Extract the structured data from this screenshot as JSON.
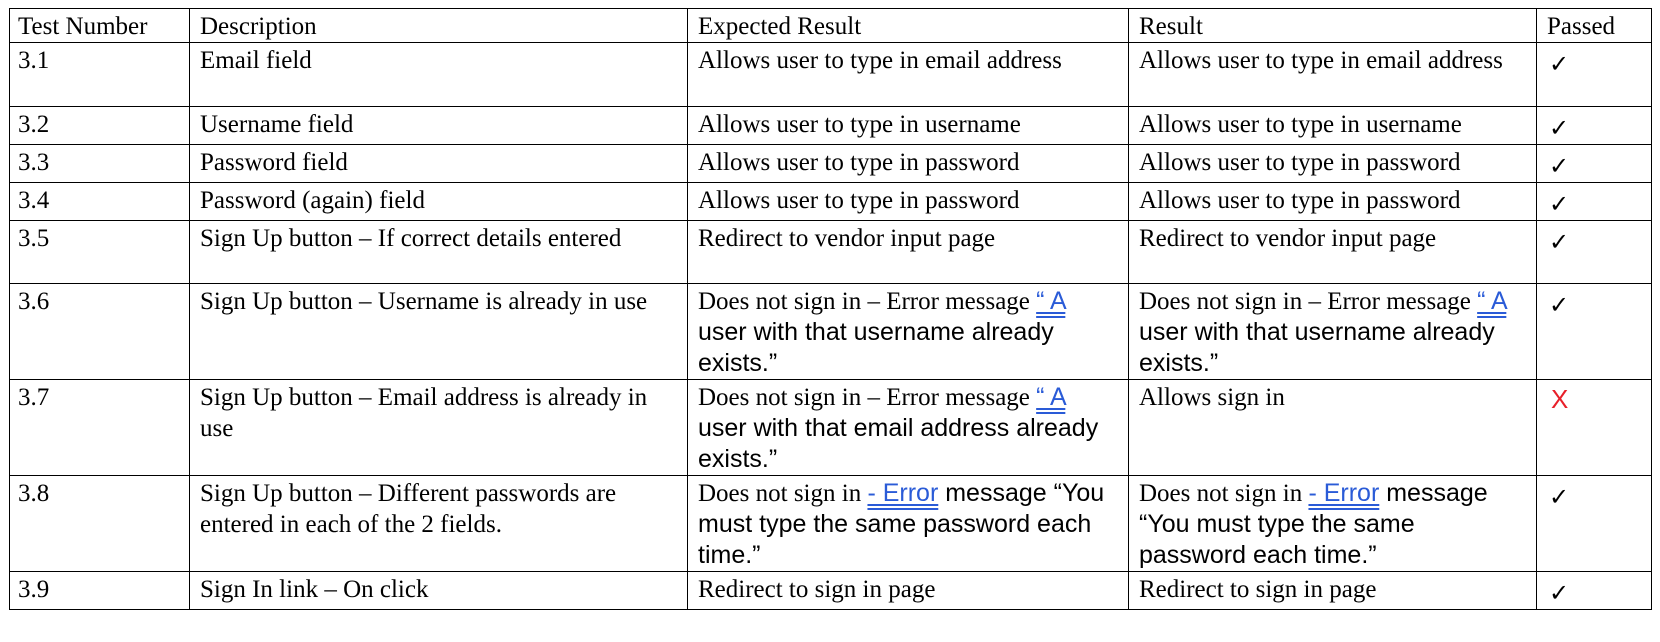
{
  "table": {
    "headers": [
      "Test Number",
      "Description",
      "Expected Result",
      "Result",
      "Passed"
    ],
    "rows": [
      {
        "num": "3.1",
        "desc": "Email field",
        "expected": "Allows user to type in email address",
        "result": "Allows user to type in email address",
        "passed": "✓"
      },
      {
        "num": "3.2",
        "desc": "Username field",
        "expected": "Allows user to type in username",
        "result": "Allows user to type in username",
        "passed": "✓"
      },
      {
        "num": "3.3",
        "desc": "Password field",
        "expected": "Allows user to type in password",
        "result": "Allows user to type in password",
        "passed": "✓"
      },
      {
        "num": "3.4",
        "desc": "Password (again) field",
        "expected": "Allows user to type in password",
        "result": "Allows user to type in password",
        "passed": "✓"
      },
      {
        "num": "3.5",
        "desc": "Sign Up button – If correct details entered",
        "expected": "Redirect to vendor input page",
        "result": "Redirect to vendor input page",
        "passed": "✓"
      },
      {
        "num": "3.6",
        "desc": "Sign Up button – Username is already in use",
        "expected": {
          "lead": "Does not sign in – Error message ",
          "link": "“ A",
          "tail": " user with that username already exists.”"
        },
        "result": {
          "lead": "Does not sign in – Error message ",
          "link": "“ A",
          "tail": " user with that username already exists.”"
        },
        "passed": "✓"
      },
      {
        "num": "3.7",
        "desc": "Sign Up button – Email address is already in use",
        "expected": {
          "lead": "Does not sign in – Error message ",
          "link": "“ A",
          "tail": " user with that email address already exists.”"
        },
        "result": "Allows sign in",
        "passed": "X"
      },
      {
        "num": "3.8",
        "desc": "Sign Up button – Different passwords are entered in each of the 2 fields.",
        "expected": {
          "lead": "Does not sign in ",
          "link": "-  Error",
          "tail": " message “You must type the same password each time.”"
        },
        "result": {
          "lead": "Does not sign in ",
          "link": "-  Error",
          "tail": " message “You must type the same password each time.”"
        },
        "passed": "✓"
      },
      {
        "num": "3.9",
        "desc": "Sign In link – On click",
        "expected": "Redirect to sign in page",
        "result": "Redirect to sign in page",
        "passed": "✓"
      }
    ]
  },
  "colors": {
    "pass": "#000000",
    "fail": "#e8202a",
    "link": "#2a5bd7",
    "border": "#000000"
  }
}
